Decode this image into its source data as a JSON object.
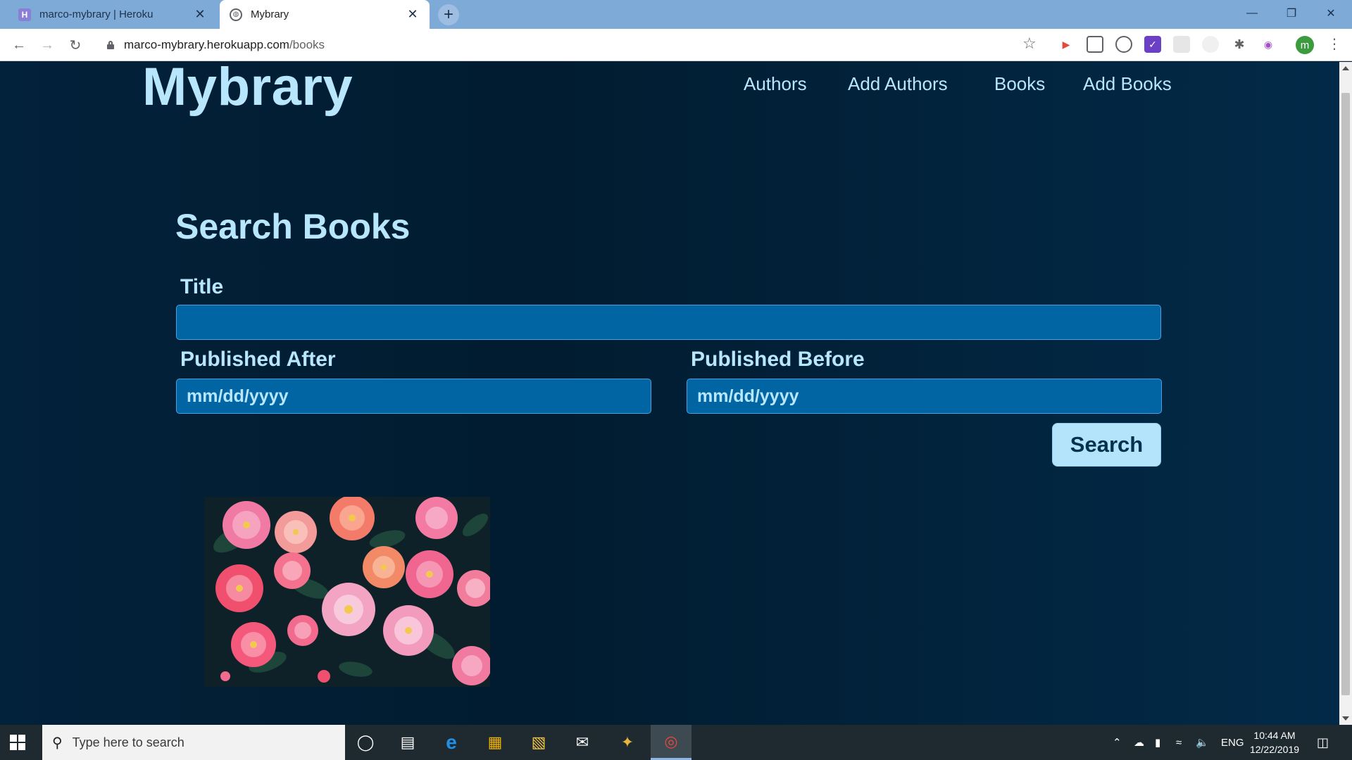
{
  "browser": {
    "tabs": [
      {
        "title": "marco-mybrary | Heroku",
        "favicon": "H",
        "active": false
      },
      {
        "title": "Mybrary",
        "favicon": "◍",
        "active": true
      }
    ],
    "new_tab_label": "+",
    "close_label": "✕",
    "window_controls": {
      "minimize": "—",
      "restore": "❐",
      "close": "✕"
    },
    "url_host": "marco-mybrary.herokuapp.com",
    "url_path": "/books",
    "profile_initial": "m"
  },
  "site": {
    "logo": "Mybrary",
    "nav": [
      "Authors",
      "Add Authors",
      "Books",
      "Add Books"
    ]
  },
  "search_form": {
    "heading": "Search Books",
    "title_label": "Title",
    "title_value": "",
    "published_after_label": "Published After",
    "published_after_placeholder": "mm/dd/yyyy",
    "published_before_label": "Published Before",
    "published_before_placeholder": "mm/dd/yyyy",
    "search_button": "Search"
  },
  "results": [
    {
      "cover": "pink-roses-image"
    }
  ],
  "taskbar": {
    "search_placeholder": "Type here to search",
    "language": "ENG",
    "time": "10:44 AM",
    "date": "12/22/2019"
  },
  "colors": {
    "page_background": "#02223a",
    "accent_text": "#b7e6fd",
    "input_background": "#0065a2",
    "button_background": "#b4e4fb"
  }
}
